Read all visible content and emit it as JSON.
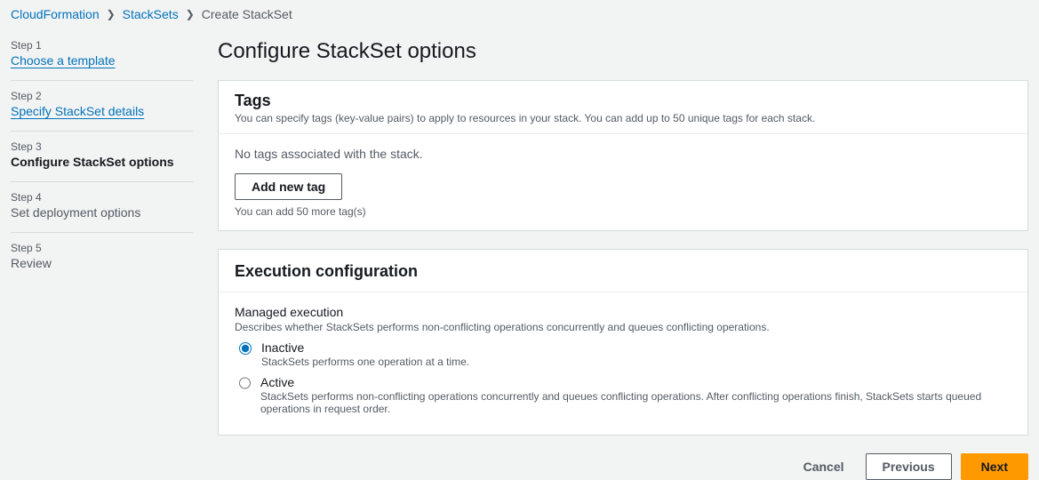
{
  "breadcrumbs": {
    "root": "CloudFormation",
    "level1": "StackSets",
    "current": "Create StackSet"
  },
  "wizard": {
    "steps": [
      {
        "num": "Step 1",
        "title": "Choose a template",
        "state": "link"
      },
      {
        "num": "Step 2",
        "title": "Specify StackSet details",
        "state": "link"
      },
      {
        "num": "Step 3",
        "title": "Configure StackSet options",
        "state": "current"
      },
      {
        "num": "Step 4",
        "title": "Set deployment options",
        "state": "upcoming"
      },
      {
        "num": "Step 5",
        "title": "Review",
        "state": "upcoming"
      }
    ]
  },
  "page_title": "Configure StackSet options",
  "tags_card": {
    "title": "Tags",
    "desc": "You can specify tags (key-value pairs) to apply to resources in your stack. You can add up to 50 unique tags for each stack.",
    "empty": "No tags associated with the stack.",
    "add_btn": "Add new tag",
    "hint": "You can add 50 more tag(s)"
  },
  "exec_card": {
    "title": "Execution configuration",
    "field_title": "Managed execution",
    "field_desc": "Describes whether StackSets performs non-conflicting operations concurrently and queues conflicting operations.",
    "options": [
      {
        "value": "inactive",
        "label": "Inactive",
        "desc": "StackSets performs one operation at a time.",
        "checked": true
      },
      {
        "value": "active",
        "label": "Active",
        "desc": "StackSets performs non-conflicting operations concurrently and queues conflicting operations. After conflicting operations finish, StackSets starts queued operations in request order.",
        "checked": false
      }
    ]
  },
  "footer": {
    "cancel": "Cancel",
    "previous": "Previous",
    "next": "Next"
  }
}
